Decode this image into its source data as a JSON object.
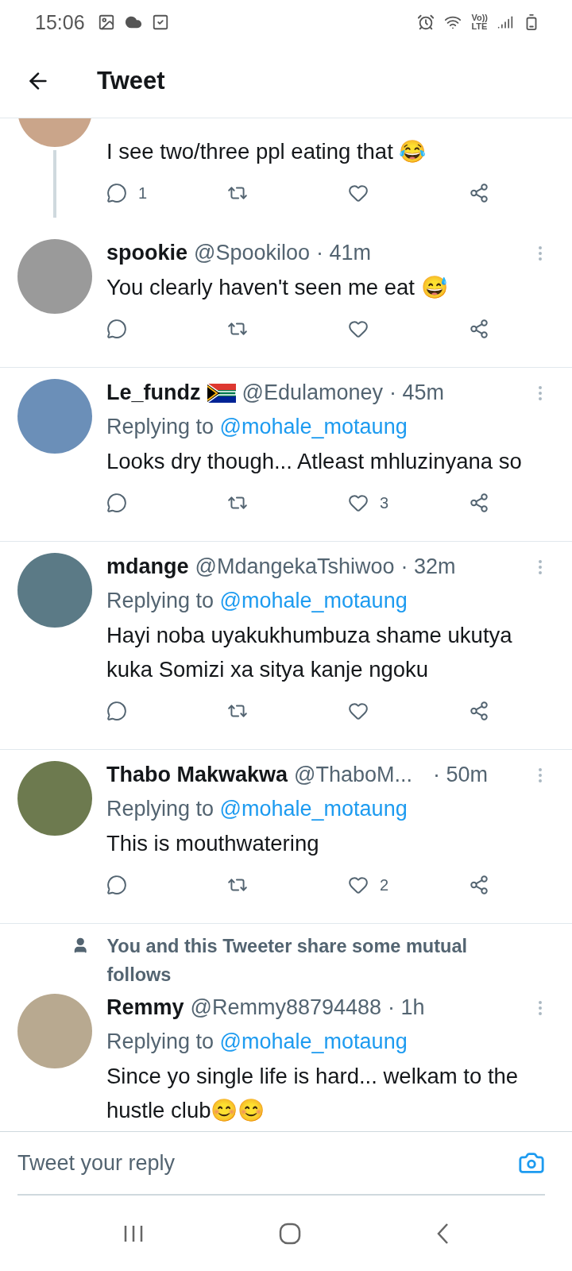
{
  "status_bar": {
    "time": "15:06",
    "network_top": "Vo))",
    "network_bottom": "LTE"
  },
  "header": {
    "title": "Tweet"
  },
  "thread_tweet": {
    "text": "I see two/three ppl eating that 😂",
    "replies": "1"
  },
  "tweets": [
    {
      "has_flag": false,
      "name": "spookie",
      "handle": "@Spookiloo",
      "time": "· 41m",
      "actions_shown": true,
      "text": "You clearly haven't seen me eat 😅"
    },
    {
      "has_flag": true,
      "name": "Le_fundz",
      "handle": "@Edulamoney",
      "time": "· 45m",
      "actions_shown": true,
      "replying_label": "Replying to",
      "replying_to": "@mohale_motaung",
      "text": "Looks dry though... Atleast mhluzinyana so",
      "likes": "3"
    },
    {
      "has_flag": false,
      "name": "mdange",
      "handle": "@MdangekaTshiwoo",
      "time": "· 32m",
      "actions_shown": true,
      "replying_label": "Replying to",
      "replying_to": "@mohale_motaung",
      "text": "Hayi noba uyakukhumbuza shame ukutya kuka Somizi xa sitya kanje ngoku"
    },
    {
      "has_flag": false,
      "name": "Thabo Makwakwa",
      "handle": "@ThaboM...",
      "time": "· 50m",
      "actions_shown": true,
      "replying_label": "Replying to",
      "replying_to": "@mohale_motaung",
      "text": "This is mouthwatering",
      "likes": "2"
    },
    {
      "has_flag": false,
      "notice": "You and this Tweeter share some mutual follows",
      "name": "Remmy",
      "handle": "@Remmy88794488",
      "time": "· 1h",
      "actions_shown": false,
      "replying_label": "Replying to",
      "replying_to": "@mohale_motaung",
      "text": "Since yo single life is hard... welkam to the hustle club😊😊"
    }
  ],
  "reply_bar": {
    "placeholder": "Tweet your reply"
  }
}
